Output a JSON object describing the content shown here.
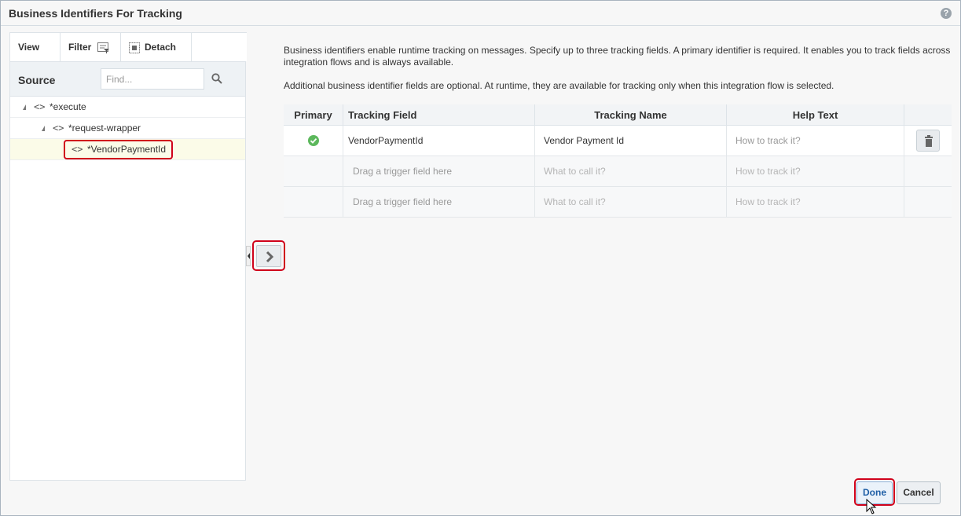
{
  "dialog": {
    "title": "Business Identifiers For Tracking",
    "help_icon": "?"
  },
  "left_panel": {
    "toolbar": {
      "view_label": "View",
      "filter_label": "Filter",
      "detach_label": "Detach"
    },
    "source_label": "Source",
    "find_placeholder": "Find...",
    "code_glyph": "<>",
    "tree": [
      {
        "label": "*execute",
        "level": 0,
        "expanded": true
      },
      {
        "label": "*request-wrapper",
        "level": 1,
        "expanded": true
      },
      {
        "label": "*VendorPaymentId",
        "level": 2,
        "selected": true
      }
    ]
  },
  "content": {
    "desc1": "Business identifiers enable runtime tracking on messages. Specify up to three tracking fields. A primary identifier is required. It enables you to track fields across integration flows and is always available.",
    "desc2": "Additional business identifier fields are optional. At runtime, they are available for tracking only when this integration flow is selected.",
    "grid": {
      "headers": [
        "Primary",
        "Tracking Field",
        "Tracking Name",
        "Help Text"
      ],
      "rows": [
        {
          "primary": true,
          "field": "VendorPaymentId",
          "name": "Vendor Payment Id",
          "help": "How to track it?"
        },
        {
          "primary": false,
          "field": "Drag a trigger field here",
          "name": "What to call it?",
          "help": "How to track it?"
        },
        {
          "primary": false,
          "field": "Drag a trigger field here",
          "name": "What to call it?",
          "help": "How to track it?"
        }
      ]
    }
  },
  "footer": {
    "done_label": "Done",
    "cancel_label": "Cancel"
  },
  "colors": {
    "highlight": "#d0021b",
    "check": "#5cb85c"
  }
}
